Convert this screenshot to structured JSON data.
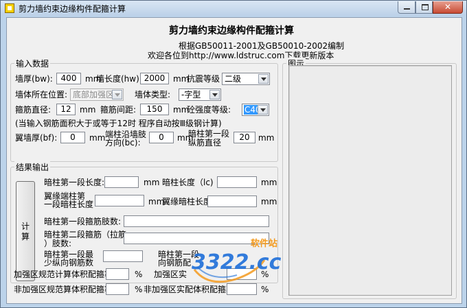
{
  "window": {
    "title": "剪力墙约束边缘构件配箍计算",
    "close_symbol": "✕"
  },
  "header": {
    "title": "剪力墙约束边缘构件配箍计算",
    "basis": "根据GB50011-2001及GB50010-2002编制",
    "welcome": "欢迎各位到http://www.ldstruc.com下载更新版本"
  },
  "input_group": {
    "label": "输入数据",
    "wall_thickness": {
      "label": "墙厚(bw):",
      "value": "400",
      "unit": "mm"
    },
    "wall_length": {
      "label": "墙长度(hw):",
      "value": "2000",
      "unit": "mm"
    },
    "seismic_grade": {
      "label": "抗震等级",
      "value": "二级"
    },
    "wall_position": {
      "label": "墙体所在位置:",
      "value": "底部加强区"
    },
    "wall_type": {
      "label": "墙体类型:",
      "value": "-字型"
    },
    "stirrup_diameter": {
      "label": "箍筋直径:",
      "value": "12",
      "unit": "mm"
    },
    "stirrup_spacing": {
      "label": "箍筋间距:",
      "value": "150",
      "unit": "mm"
    },
    "concrete_grade": {
      "label": "砼强度等级:",
      "value": "C40"
    },
    "note": "(当输入钢筋面积大于或等于12时 程序自动按Ⅲ级钢计算)",
    "flange_thickness": {
      "label": "翼墙厚(bf):",
      "value": "0",
      "unit": "mm"
    },
    "end_column_length": {
      "label_line1": "端柱沿墙肢",
      "label_line2": "方向(bc):",
      "value": "0",
      "unit": "mm"
    },
    "hidden_col_first_bar_dia": {
      "label_line1": "暗柱第一段",
      "label_line2": "纵筋直径",
      "value": "20",
      "unit": "mm"
    }
  },
  "result_group": {
    "label": "结果输出",
    "calc_button": "计\n算",
    "first_segment_length": {
      "label": "暗柱第一段长度:",
      "unit": "mm"
    },
    "column_length": {
      "label": "暗柱长度（lc)",
      "unit": "mm"
    },
    "flange_end_first_length": {
      "label_line1": "翼缘端柱第",
      "label_line2": "一段暗柱长度",
      "unit": "mm"
    },
    "flange_hidden_column_length": {
      "label": "翼缘暗柱长度",
      "unit": "mm"
    },
    "first_segment_legs": {
      "label": "暗柱第一段箍筋肢数:"
    },
    "second_segment_legs": {
      "label_line1": "暗柱第二段箍筋（拉筋",
      "label_line2": "）肢数:"
    },
    "first_segment_min_rebar": {
      "label_line1": "暗柱第一段最",
      "label_line2": "少纵向钢筋数"
    },
    "first_segment_rebar_2": {
      "label_line1": "暗柱第一段",
      "label_line2": "向钢筋配"
    },
    "reinforced_standard_ratio": {
      "label": "加强区规范计算体积配箍率",
      "unit": "%"
    },
    "reinforced_actual_ratio": {
      "label": "加强区实",
      "unit": "%"
    },
    "nonreinforced_standard_ratio": {
      "label": "非加强区规范算体积配箍率",
      "unit": "%"
    },
    "nonreinforced_actual_ratio": {
      "label": "非加强区实配体积配箍率",
      "unit": "%"
    }
  },
  "drawing_group": {
    "label": "图示"
  },
  "watermark": {
    "text": "3322.cc",
    "site_label": "软件站"
  },
  "colors": {
    "accent": "#3399ff",
    "watermark_blue": "#1e6fd9",
    "watermark_orange": "#f39a1e"
  }
}
